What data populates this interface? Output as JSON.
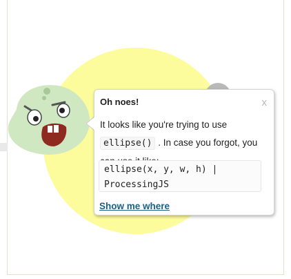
{
  "bubble": {
    "title": "Oh noes!",
    "close_label": "x",
    "message_before_code": "It looks like you're trying to use",
    "inline_code": "ellipse()",
    "message_after_code": ". In case you forgot, you can use it like:",
    "code_line_1": "ellipse(x, y, w, h) |",
    "code_line_2": "ProcessingJS",
    "link_label": "Show me where"
  },
  "colors": {
    "canvas_circle": "#fdfc9c",
    "canvas_gray_circle": "#b9b9b9",
    "monster_body": "#cfe8c2",
    "link": "#1b5f86"
  },
  "icons": {
    "monster": "error-buddy-monster-icon",
    "close": "close-icon"
  }
}
